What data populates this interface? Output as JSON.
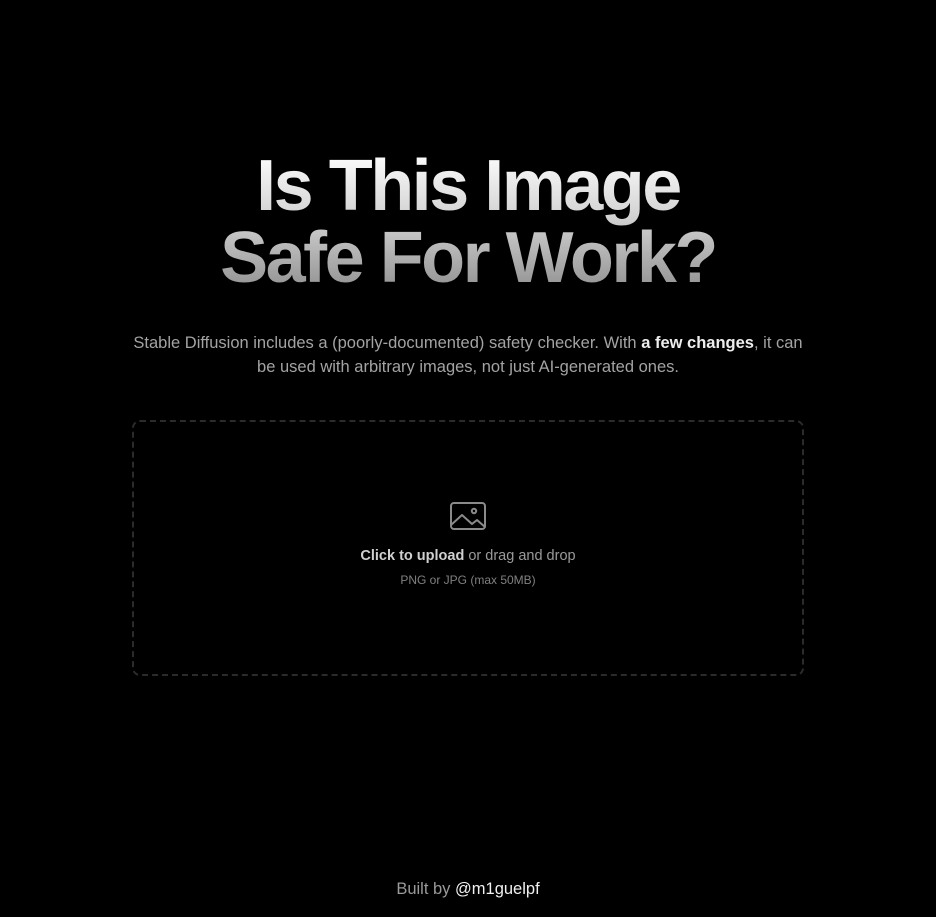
{
  "hero": {
    "line1": "Is This Image",
    "line2": "Safe For Work?"
  },
  "subtitle": {
    "text_before": "Stable Diffusion includes a (poorly-documented) safety checker. With ",
    "link_label": "a few changes",
    "text_after": ", it can be used with arbitrary images, not just AI-generated ones."
  },
  "upload": {
    "icon": "image-icon",
    "action_label": "Click to upload",
    "action_suffix": " or drag and drop",
    "hint": "PNG or JPG (max 50MB)"
  },
  "footer": {
    "prefix": "Built by ",
    "author_handle": "@m1guelpf"
  },
  "colors": {
    "background": "#000000",
    "dropzone_border": "#2b2b2b",
    "link": "#ededed"
  }
}
